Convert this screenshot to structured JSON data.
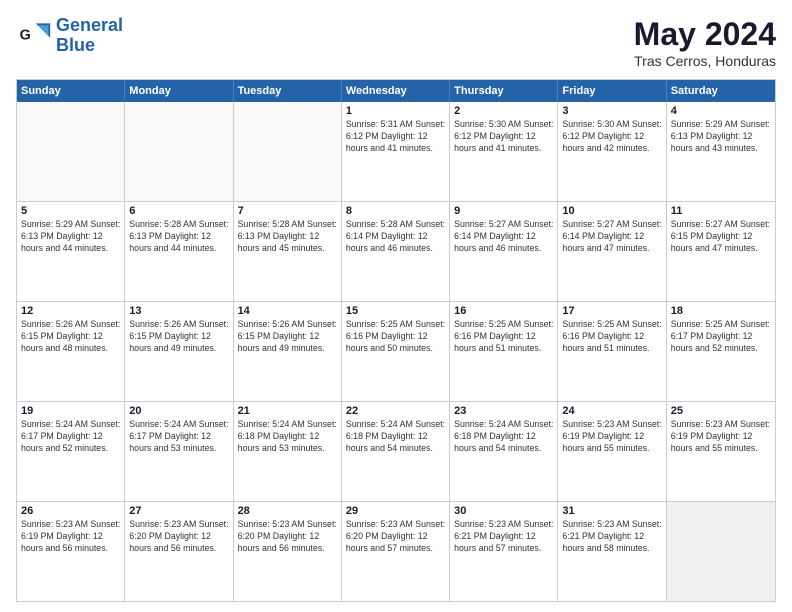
{
  "logo": {
    "line1": "General",
    "line2": "Blue"
  },
  "header": {
    "title": "May 2024",
    "subtitle": "Tras Cerros, Honduras"
  },
  "weekdays": [
    "Sunday",
    "Monday",
    "Tuesday",
    "Wednesday",
    "Thursday",
    "Friday",
    "Saturday"
  ],
  "rows": [
    [
      {
        "day": "",
        "info": ""
      },
      {
        "day": "",
        "info": ""
      },
      {
        "day": "",
        "info": ""
      },
      {
        "day": "1",
        "info": "Sunrise: 5:31 AM\nSunset: 6:12 PM\nDaylight: 12 hours\nand 41 minutes."
      },
      {
        "day": "2",
        "info": "Sunrise: 5:30 AM\nSunset: 6:12 PM\nDaylight: 12 hours\nand 41 minutes."
      },
      {
        "day": "3",
        "info": "Sunrise: 5:30 AM\nSunset: 6:12 PM\nDaylight: 12 hours\nand 42 minutes."
      },
      {
        "day": "4",
        "info": "Sunrise: 5:29 AM\nSunset: 6:13 PM\nDaylight: 12 hours\nand 43 minutes."
      }
    ],
    [
      {
        "day": "5",
        "info": "Sunrise: 5:29 AM\nSunset: 6:13 PM\nDaylight: 12 hours\nand 44 minutes."
      },
      {
        "day": "6",
        "info": "Sunrise: 5:28 AM\nSunset: 6:13 PM\nDaylight: 12 hours\nand 44 minutes."
      },
      {
        "day": "7",
        "info": "Sunrise: 5:28 AM\nSunset: 6:13 PM\nDaylight: 12 hours\nand 45 minutes."
      },
      {
        "day": "8",
        "info": "Sunrise: 5:28 AM\nSunset: 6:14 PM\nDaylight: 12 hours\nand 46 minutes."
      },
      {
        "day": "9",
        "info": "Sunrise: 5:27 AM\nSunset: 6:14 PM\nDaylight: 12 hours\nand 46 minutes."
      },
      {
        "day": "10",
        "info": "Sunrise: 5:27 AM\nSunset: 6:14 PM\nDaylight: 12 hours\nand 47 minutes."
      },
      {
        "day": "11",
        "info": "Sunrise: 5:27 AM\nSunset: 6:15 PM\nDaylight: 12 hours\nand 47 minutes."
      }
    ],
    [
      {
        "day": "12",
        "info": "Sunrise: 5:26 AM\nSunset: 6:15 PM\nDaylight: 12 hours\nand 48 minutes."
      },
      {
        "day": "13",
        "info": "Sunrise: 5:26 AM\nSunset: 6:15 PM\nDaylight: 12 hours\nand 49 minutes."
      },
      {
        "day": "14",
        "info": "Sunrise: 5:26 AM\nSunset: 6:15 PM\nDaylight: 12 hours\nand 49 minutes."
      },
      {
        "day": "15",
        "info": "Sunrise: 5:25 AM\nSunset: 6:16 PM\nDaylight: 12 hours\nand 50 minutes."
      },
      {
        "day": "16",
        "info": "Sunrise: 5:25 AM\nSunset: 6:16 PM\nDaylight: 12 hours\nand 51 minutes."
      },
      {
        "day": "17",
        "info": "Sunrise: 5:25 AM\nSunset: 6:16 PM\nDaylight: 12 hours\nand 51 minutes."
      },
      {
        "day": "18",
        "info": "Sunrise: 5:25 AM\nSunset: 6:17 PM\nDaylight: 12 hours\nand 52 minutes."
      }
    ],
    [
      {
        "day": "19",
        "info": "Sunrise: 5:24 AM\nSunset: 6:17 PM\nDaylight: 12 hours\nand 52 minutes."
      },
      {
        "day": "20",
        "info": "Sunrise: 5:24 AM\nSunset: 6:17 PM\nDaylight: 12 hours\nand 53 minutes."
      },
      {
        "day": "21",
        "info": "Sunrise: 5:24 AM\nSunset: 6:18 PM\nDaylight: 12 hours\nand 53 minutes."
      },
      {
        "day": "22",
        "info": "Sunrise: 5:24 AM\nSunset: 6:18 PM\nDaylight: 12 hours\nand 54 minutes."
      },
      {
        "day": "23",
        "info": "Sunrise: 5:24 AM\nSunset: 6:18 PM\nDaylight: 12 hours\nand 54 minutes."
      },
      {
        "day": "24",
        "info": "Sunrise: 5:23 AM\nSunset: 6:19 PM\nDaylight: 12 hours\nand 55 minutes."
      },
      {
        "day": "25",
        "info": "Sunrise: 5:23 AM\nSunset: 6:19 PM\nDaylight: 12 hours\nand 55 minutes."
      }
    ],
    [
      {
        "day": "26",
        "info": "Sunrise: 5:23 AM\nSunset: 6:19 PM\nDaylight: 12 hours\nand 56 minutes."
      },
      {
        "day": "27",
        "info": "Sunrise: 5:23 AM\nSunset: 6:20 PM\nDaylight: 12 hours\nand 56 minutes."
      },
      {
        "day": "28",
        "info": "Sunrise: 5:23 AM\nSunset: 6:20 PM\nDaylight: 12 hours\nand 56 minutes."
      },
      {
        "day": "29",
        "info": "Sunrise: 5:23 AM\nSunset: 6:20 PM\nDaylight: 12 hours\nand 57 minutes."
      },
      {
        "day": "30",
        "info": "Sunrise: 5:23 AM\nSunset: 6:21 PM\nDaylight: 12 hours\nand 57 minutes."
      },
      {
        "day": "31",
        "info": "Sunrise: 5:23 AM\nSunset: 6:21 PM\nDaylight: 12 hours\nand 58 minutes."
      },
      {
        "day": "",
        "info": ""
      }
    ]
  ]
}
